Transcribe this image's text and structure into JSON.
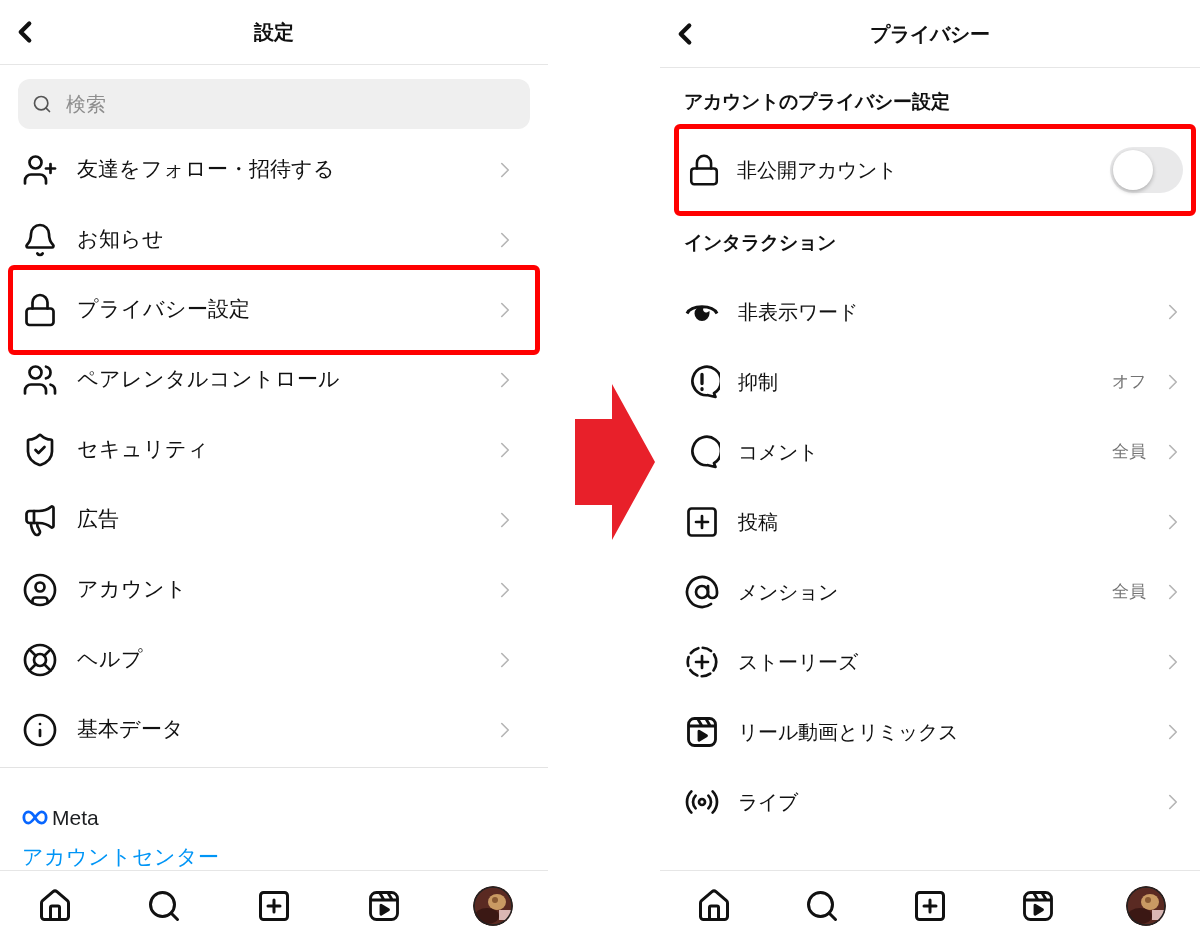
{
  "settings_screen": {
    "title": "設定",
    "search": {
      "placeholder": "検索"
    },
    "items": [
      {
        "label": "友達をフォロー・招待する",
        "highlighted": false
      },
      {
        "label": "お知らせ",
        "highlighted": false
      },
      {
        "label": "プライバシー設定",
        "highlighted": true
      },
      {
        "label": "ペアレンタルコントロール",
        "highlighted": false
      },
      {
        "label": "セキュリティ",
        "highlighted": false
      },
      {
        "label": "広告",
        "highlighted": false
      },
      {
        "label": "アカウント",
        "highlighted": false
      },
      {
        "label": "ヘルプ",
        "highlighted": false
      },
      {
        "label": "基本データ",
        "highlighted": false
      }
    ],
    "footer": {
      "brand": "Meta",
      "link": "アカウントセンター"
    }
  },
  "privacy_screen": {
    "title": "プライバシー",
    "account_section": {
      "heading": "アカウントのプライバシー設定",
      "private_account": {
        "label": "非公開アカウント",
        "on": false,
        "highlighted": true
      }
    },
    "interaction_section": {
      "heading": "インタラクション",
      "items": [
        {
          "label": "非表示ワード"
        },
        {
          "label": "抑制",
          "value": "オフ"
        },
        {
          "label": "コメント",
          "value": "全員"
        },
        {
          "label": "投稿"
        },
        {
          "label": "メンション",
          "value": "全員"
        },
        {
          "label": "ストーリーズ"
        },
        {
          "label": "リール動画とリミックス"
        },
        {
          "label": "ライブ"
        }
      ]
    }
  }
}
